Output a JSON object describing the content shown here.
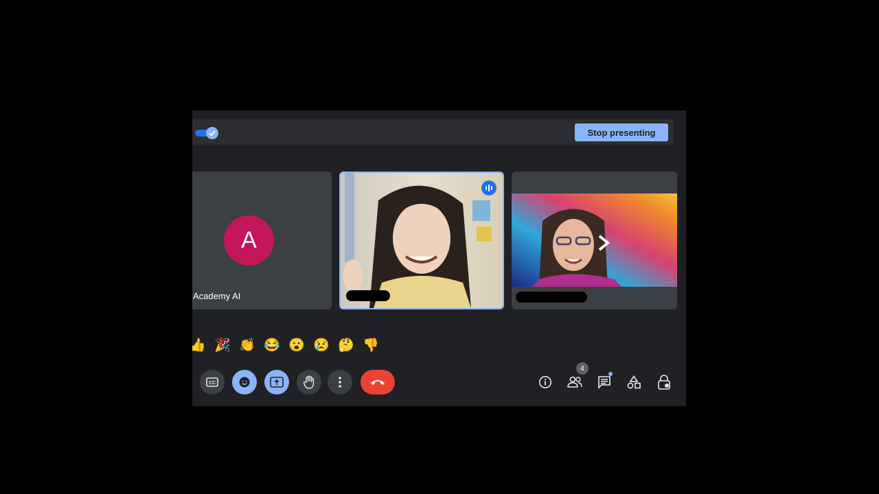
{
  "present_bar": {
    "stop_label": "Stop presenting"
  },
  "participants": [
    {
      "avatar_letter": "A",
      "name": "Academy AI"
    },
    {
      "name": ""
    },
    {
      "name": ""
    }
  ],
  "reactions": [
    "👍",
    "🎉",
    "👏",
    "😂",
    "😮",
    "😢",
    "🤔",
    "👎"
  ],
  "controls": {
    "captions_icon": "captions-icon",
    "emoji_icon": "emoji-icon",
    "present_icon": "present-screen-icon",
    "hand_icon": "raise-hand-icon",
    "more_icon": "more-options-icon",
    "end_icon": "end-call-icon"
  },
  "side_panel": {
    "people_count": "4",
    "icons": [
      "info-icon",
      "people-icon",
      "chat-icon",
      "activities-icon",
      "host-controls-icon"
    ]
  },
  "colors": {
    "accent": "#8ab4f8",
    "avatar": "#c2185b",
    "end_call": "#ea4335",
    "surface": "#202124"
  }
}
